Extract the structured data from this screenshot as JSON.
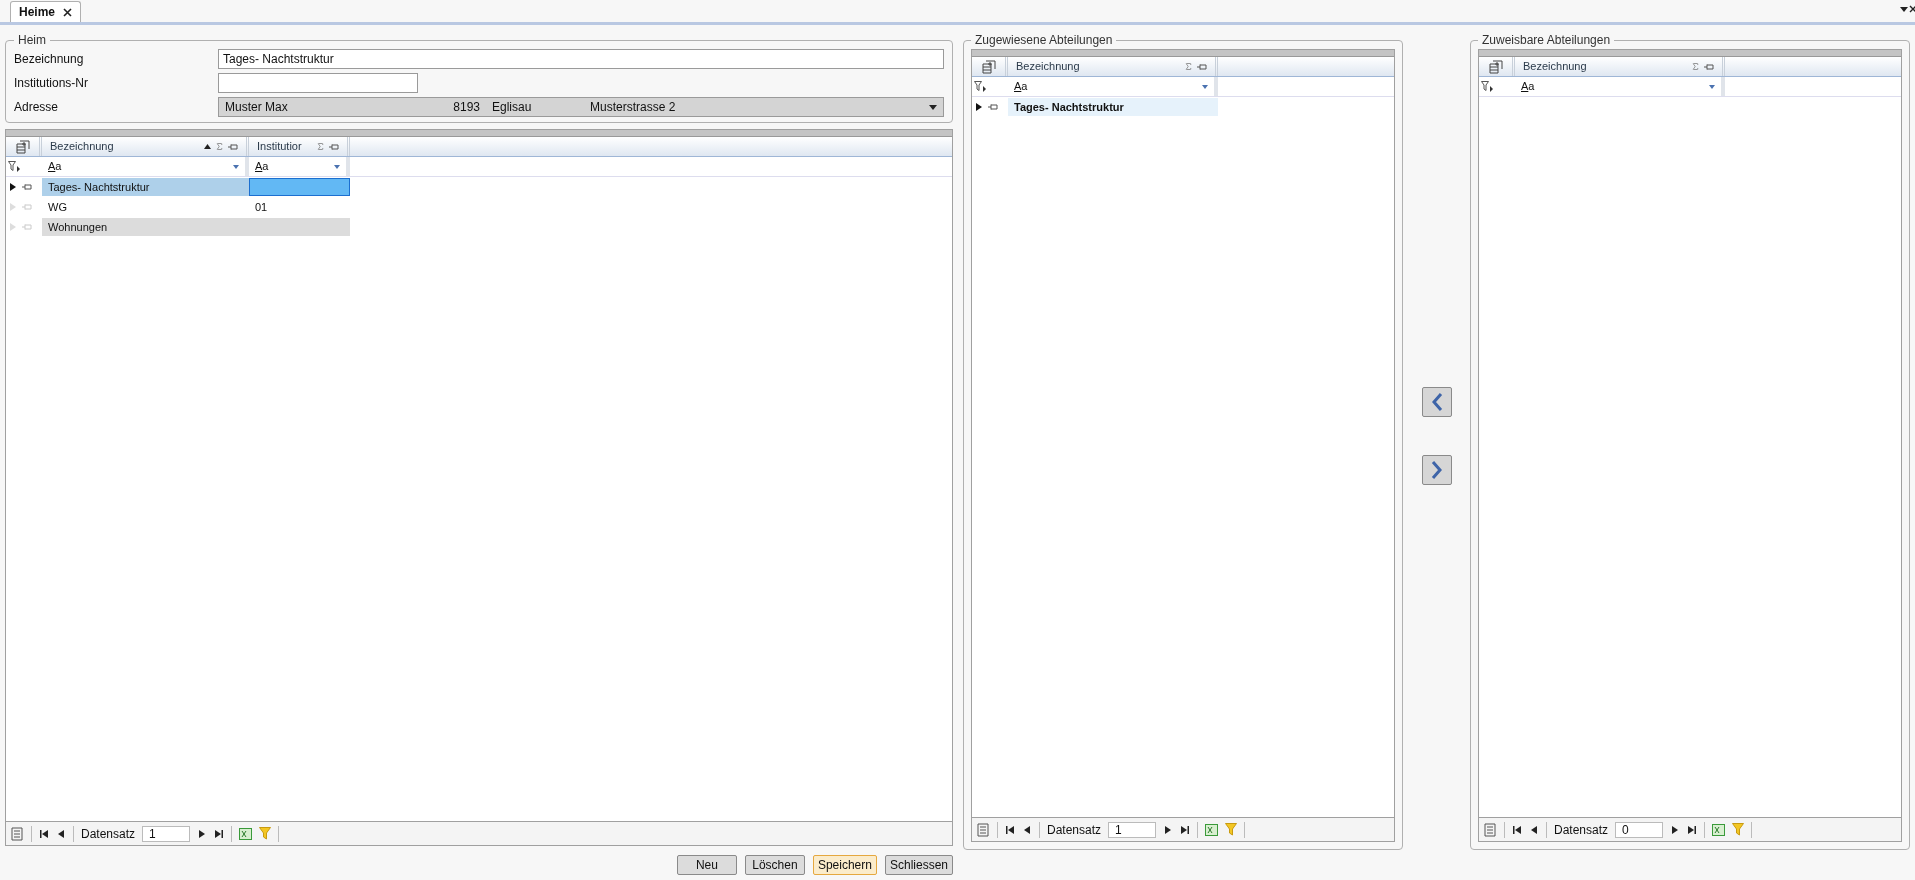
{
  "tab": {
    "label": "Heime",
    "selected": true
  },
  "heim": {
    "title": "Heim",
    "fields": [
      {
        "kind": "text",
        "label": "Bezeichnung",
        "value": "Tages- Nachtstruktur",
        "wide": true
      },
      {
        "kind": "text",
        "label": "Institutions-Nr",
        "wide": false
      },
      {
        "kind": "combo",
        "label": "Adresse",
        "parts": [
          "Muster Max",
          "8193",
          "Eglisau",
          "Musterstrasse 2"
        ]
      }
    ]
  },
  "heime_grid": {
    "columns": [
      {
        "label": "Bezeichnung",
        "sorted": true,
        "filter": "Aa"
      },
      {
        "label": "Institutior",
        "sorted": false,
        "filter": "Aa"
      }
    ],
    "rows": [
      {
        "cells": [
          "Tages- Nachtstruktur"
        ],
        "selected": true,
        "inactive": false
      },
      {
        "cells": [
          "WG",
          "01"
        ],
        "selected": false,
        "inactive": false
      },
      {
        "cells": [
          "Wohnungen"
        ],
        "selected": false,
        "inactive": true
      }
    ],
    "navigator": {
      "label": "Datensatz",
      "value": "1"
    }
  },
  "assigned": {
    "title": "Zugewiesene Abteilungen",
    "columns": [
      {
        "label": "Bezeichnung",
        "sorted": false,
        "filter": "Aa"
      }
    ],
    "rows": [
      {
        "cells": [
          "Tages- Nachtstruktur"
        ],
        "selected": true,
        "inactive": false
      }
    ],
    "navigator": {
      "label": "Datensatz",
      "value": "1"
    }
  },
  "assignable": {
    "title": "Zuweisbare Abteilungen",
    "columns": [
      {
        "label": "Bezeichnung",
        "sorted": false,
        "filter": "Aa"
      }
    ],
    "navigator": {
      "label": "Datensatz",
      "value": "0"
    }
  },
  "buttons": [
    {
      "label": "Neu",
      "focused": false
    },
    {
      "label": "Löschen",
      "focused": false
    },
    {
      "label": "Speichern",
      "focused": true
    },
    {
      "label": "Schliessen",
      "focused": false
    }
  ]
}
